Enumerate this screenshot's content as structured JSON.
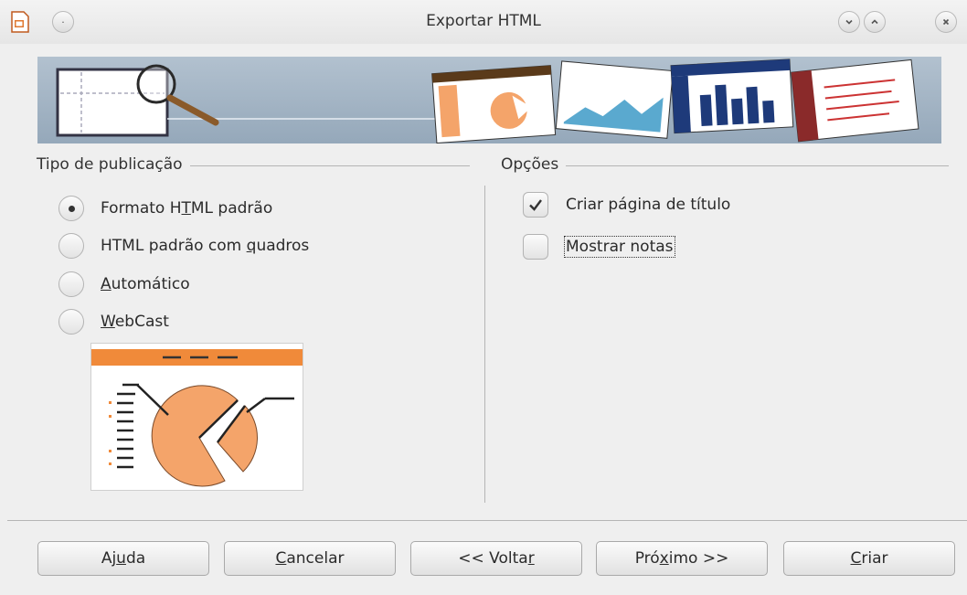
{
  "window": {
    "title": "Exportar HTML"
  },
  "publication": {
    "label": "Tipo de publicação",
    "options": [
      {
        "pre": "Formato H",
        "acc": "T",
        "post": "ML padrão",
        "selected": true
      },
      {
        "pre": "HTML padrão com ",
        "acc": "q",
        "post": "uadros",
        "selected": false
      },
      {
        "pre": "",
        "acc": "A",
        "post": "utomático",
        "selected": false
      },
      {
        "pre": "",
        "acc": "W",
        "post": "ebCast",
        "selected": false
      }
    ]
  },
  "options": {
    "label": "Opções",
    "items": [
      {
        "label": "Criar página de título",
        "checked": true
      },
      {
        "label": "Mostrar notas",
        "checked": false
      }
    ]
  },
  "buttons": [
    {
      "pre": "Aj",
      "acc": "u",
      "post": "da"
    },
    {
      "pre": "",
      "acc": "C",
      "post": "ancelar"
    },
    {
      "pre": "<< Volta",
      "acc": "r",
      "post": ""
    },
    {
      "pre": "Pró",
      "acc": "x",
      "post": "imo >>"
    },
    {
      "pre": "",
      "acc": "C",
      "post": "riar"
    }
  ],
  "colors": {
    "accent": "#f4a46a",
    "preview_accent": "#f08a3a"
  }
}
